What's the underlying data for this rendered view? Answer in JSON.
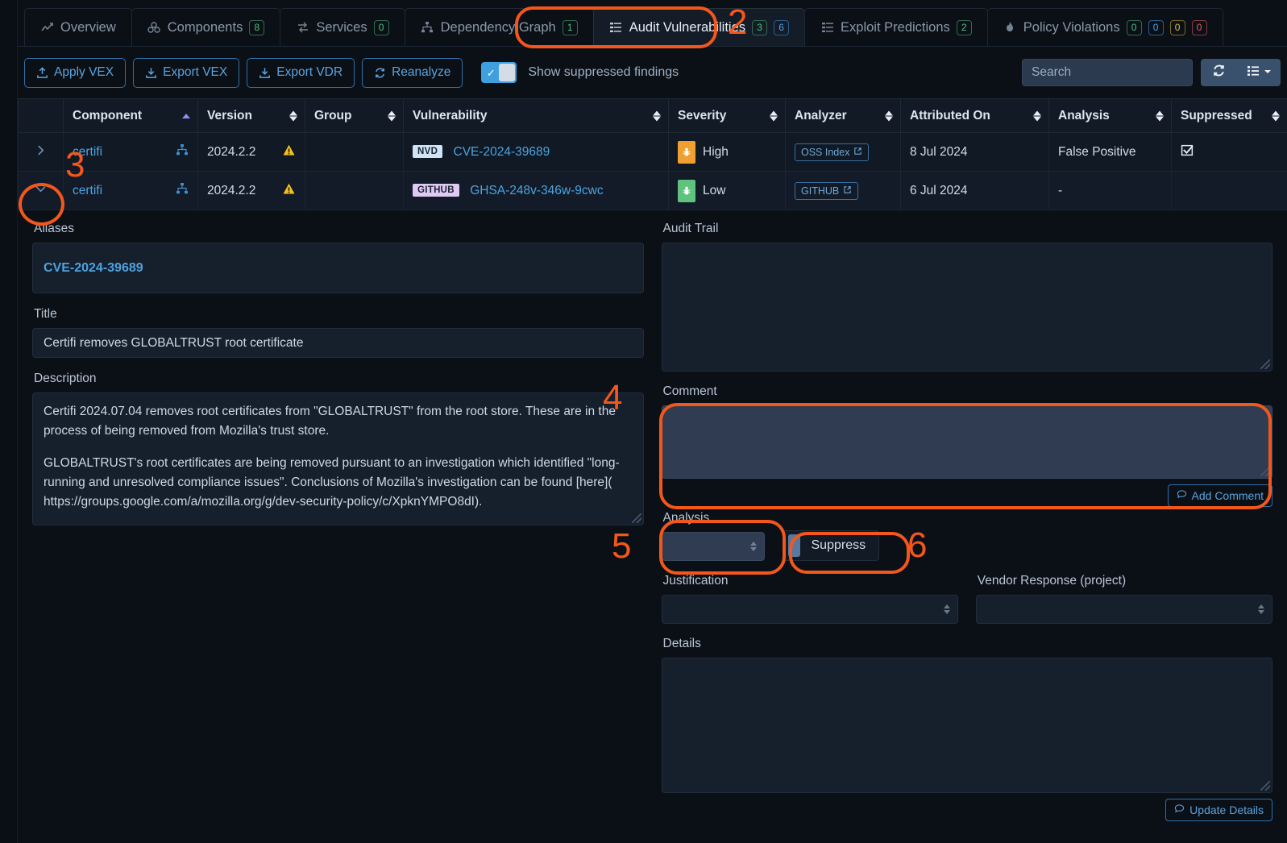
{
  "tabs": [
    {
      "label": "Overview",
      "icon": "chart-line-icon",
      "badges": [],
      "active": false
    },
    {
      "label": "Components",
      "icon": "components-icon",
      "badges": [
        {
          "value": "8",
          "color": "green"
        }
      ],
      "active": false
    },
    {
      "label": "Services",
      "icon": "services-icon",
      "badges": [
        {
          "value": "0",
          "color": "green"
        }
      ],
      "active": false
    },
    {
      "label": "Dependency Graph",
      "icon": "sitemap-icon",
      "badges": [
        {
          "value": "1",
          "color": "green"
        }
      ],
      "active": false
    },
    {
      "label": "Audit Vulnerabilities",
      "icon": "list-icon",
      "badges": [
        {
          "value": "3",
          "color": "green"
        },
        {
          "value": "6",
          "color": "blue"
        }
      ],
      "active": true
    },
    {
      "label": "Exploit Predictions",
      "icon": "list-icon",
      "badges": [
        {
          "value": "2",
          "color": "green"
        }
      ],
      "active": false
    },
    {
      "label": "Policy Violations",
      "icon": "flame-icon",
      "badges": [
        {
          "value": "0",
          "color": "green"
        },
        {
          "value": "0",
          "color": "blue"
        },
        {
          "value": "0",
          "color": "yellow"
        },
        {
          "value": "0",
          "color": "red"
        }
      ],
      "active": false
    }
  ],
  "toolbar": {
    "buttons": [
      {
        "label": "Apply VEX",
        "icon": "upload-icon"
      },
      {
        "label": "Export VEX",
        "icon": "download-icon"
      },
      {
        "label": "Export VDR",
        "icon": "download-icon"
      },
      {
        "label": "Reanalyze",
        "icon": "refresh-icon"
      }
    ],
    "show_suppressed_label": "Show suppressed findings",
    "show_suppressed_on": true,
    "search_placeholder": "Search",
    "search_value": "",
    "refresh_icon": "refresh-icon",
    "view_icon": "list-view-icon",
    "view_caret": "chevron-down-icon"
  },
  "table": {
    "columns": [
      {
        "label": "",
        "sort": "none"
      },
      {
        "label": "Component",
        "sort": "asc"
      },
      {
        "label": "Version",
        "sort": "both"
      },
      {
        "label": "Group",
        "sort": "both"
      },
      {
        "label": "Vulnerability",
        "sort": "both"
      },
      {
        "label": "Severity",
        "sort": "both"
      },
      {
        "label": "Analyzer",
        "sort": "both"
      },
      {
        "label": "Attributed On",
        "sort": "both"
      },
      {
        "label": "Analysis",
        "sort": "both"
      },
      {
        "label": "Suppressed",
        "sort": "both"
      }
    ],
    "rows": [
      {
        "expanded": false,
        "expander_icon": "chevron-right-icon",
        "component": "certifi",
        "component_icon": "sitemap-icon",
        "version": "2024.2.2",
        "version_warning_icon": "warning-triangle-icon",
        "group": "",
        "vuln_source": "NVD",
        "vuln_source_style": "nvd",
        "vulnerability": "CVE-2024-39689",
        "severity": "High",
        "severity_style": "high",
        "severity_icon": "bug-icon",
        "analyzer": "OSS Index",
        "analyzer_icon": "external-link-icon",
        "attributed_on": "8 Jul 2024",
        "analysis": "False Positive",
        "suppressed": true,
        "suppressed_icon": "checked-box-icon"
      },
      {
        "expanded": true,
        "expander_icon": "chevron-down-icon",
        "component": "certifi",
        "component_icon": "sitemap-icon",
        "version": "2024.2.2",
        "version_warning_icon": "warning-triangle-icon",
        "group": "",
        "vuln_source": "GITHUB",
        "vuln_source_style": "github",
        "vulnerability": "GHSA-248v-346w-9cwc",
        "severity": "Low",
        "severity_style": "low",
        "severity_icon": "bug-icon",
        "analyzer": "GITHUB",
        "analyzer_icon": "external-link-icon",
        "attributed_on": "6 Jul 2024",
        "analysis": "-",
        "suppressed": false,
        "suppressed_icon": ""
      }
    ]
  },
  "detail": {
    "aliases_label": "Aliases",
    "alias_value": "CVE-2024-39689",
    "title_label": "Title",
    "title_value": "Certifi removes GLOBALTRUST root certificate",
    "description_label": "Description",
    "description_p1": "Certifi 2024.07.04 removes root certificates from \"GLOBALTRUST\" from the root store. These are in the process of being removed from Mozilla's trust store.",
    "description_p2": "GLOBALTRUST's root certificates are being removed pursuant to an investigation which identified \"long-running and unresolved compliance issues\". Conclusions of Mozilla's investigation can be found [here]( https://groups.google.com/a/mozilla.org/g/dev-security-policy/c/XpknYMPO8dI).",
    "audit_trail_label": "Audit Trail",
    "audit_trail_value": "",
    "comment_label": "Comment",
    "comment_value": "",
    "add_comment_label": "Add Comment",
    "add_comment_icon": "comment-icon",
    "analysis_label": "Analysis",
    "analysis_value": "",
    "suppress_label": "Suppress",
    "suppress_on": false,
    "justification_label": "Justification",
    "justification_value": "",
    "vendor_response_label": "Vendor Response (project)",
    "vendor_response_value": "",
    "details_label": "Details",
    "details_value": "",
    "update_details_label": "Update Details",
    "update_details_icon": "comment-icon"
  },
  "annotations": [
    {
      "number": "2",
      "target": "audit-vulnerabilities-tab"
    },
    {
      "number": "3",
      "target": "row-expander"
    },
    {
      "number": "4",
      "target": "comment-textarea"
    },
    {
      "number": "5",
      "target": "analysis-select"
    },
    {
      "number": "6",
      "target": "suppress-toggle"
    }
  ],
  "colors": {
    "accent": "#f4571b",
    "link": "#4da3e0",
    "severity_high": "#f0a030",
    "severity_low": "#5fc37e"
  }
}
